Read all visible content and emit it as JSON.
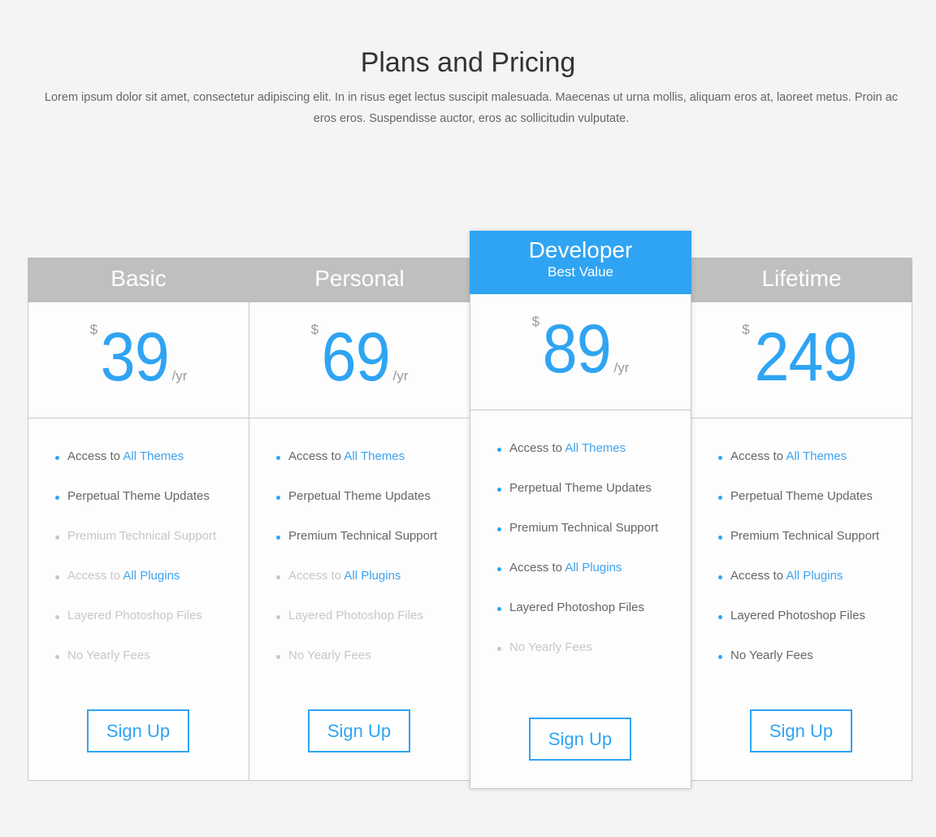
{
  "header": {
    "title": "Plans and Pricing",
    "description": "Lorem ipsum dolor sit amet, consectetur adipiscing elit. In in risus eget lectus suscipit malesuada. Maecenas ut urna mollis, aliquam eros at, laoreet metus. Proin ac eros eros. Suspendisse auctor, eros ac sollicitudin vulputate."
  },
  "colors": {
    "accent": "#2fa4f3",
    "header_gray": "#bfbfbf",
    "text": "#666666",
    "disabled": "#c7c7c7"
  },
  "plans": [
    {
      "name": "Basic",
      "currency": "$",
      "price": "39",
      "period": "/yr",
      "button": "Sign Up",
      "featured": false,
      "features": [
        {
          "text": "Access to ",
          "link": "All Themes",
          "enabled": true
        },
        {
          "text": "Perpetual Theme Updates",
          "enabled": true
        },
        {
          "text": "Premium Technical Support",
          "enabled": false
        },
        {
          "text": "Access to ",
          "link": "All Plugins",
          "enabled": false
        },
        {
          "text": "Layered Photoshop Files",
          "enabled": false
        },
        {
          "text": "No Yearly Fees",
          "enabled": false
        }
      ]
    },
    {
      "name": "Personal",
      "currency": "$",
      "price": "69",
      "period": "/yr",
      "button": "Sign Up",
      "featured": false,
      "features": [
        {
          "text": "Access to ",
          "link": "All Themes",
          "enabled": true
        },
        {
          "text": "Perpetual Theme Updates",
          "enabled": true
        },
        {
          "text": "Premium Technical Support",
          "enabled": true
        },
        {
          "text": "Access to ",
          "link": "All Plugins",
          "enabled": false
        },
        {
          "text": "Layered Photoshop Files",
          "enabled": false
        },
        {
          "text": "No Yearly Fees",
          "enabled": false
        }
      ]
    },
    {
      "name": "Developer",
      "subtitle": "Best Value",
      "currency": "$",
      "price": "89",
      "period": "/yr",
      "button": "Sign Up",
      "featured": true,
      "features": [
        {
          "text": "Access to ",
          "link": "All Themes",
          "enabled": true
        },
        {
          "text": "Perpetual Theme Updates",
          "enabled": true
        },
        {
          "text": "Premium Technical Support",
          "enabled": true
        },
        {
          "text": "Access to ",
          "link": "All Plugins",
          "enabled": true
        },
        {
          "text": "Layered Photoshop Files",
          "enabled": true
        },
        {
          "text": "No Yearly Fees",
          "enabled": false
        }
      ]
    },
    {
      "name": "Lifetime",
      "currency": "$",
      "price": "249",
      "period": "",
      "button": "Sign Up",
      "featured": false,
      "features": [
        {
          "text": "Access to ",
          "link": "All Themes",
          "enabled": true
        },
        {
          "text": "Perpetual Theme Updates",
          "enabled": true
        },
        {
          "text": "Premium Technical Support",
          "enabled": true
        },
        {
          "text": "Access to ",
          "link": "All Plugins",
          "enabled": true
        },
        {
          "text": "Layered Photoshop Files",
          "enabled": true
        },
        {
          "text": "No Yearly Fees",
          "enabled": true
        }
      ]
    }
  ]
}
